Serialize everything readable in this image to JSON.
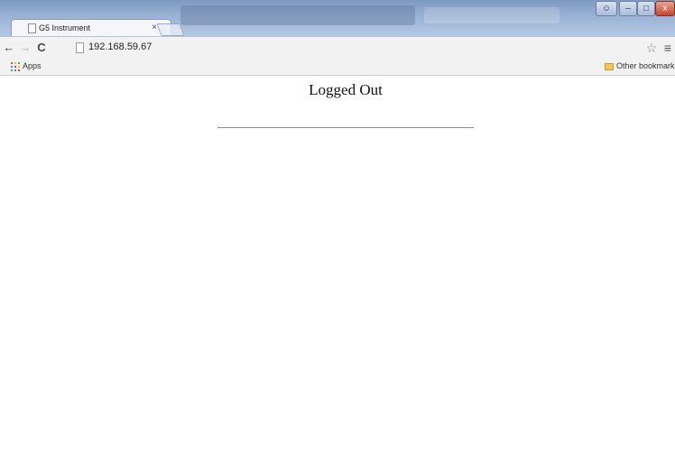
{
  "browser": {
    "tab": {
      "title": "G5 Instrument",
      "close_glyph": "×",
      "icon": "page-icon"
    },
    "window_controls": {
      "user_glyph": "☺",
      "minimize_glyph": "–",
      "maximize_glyph": "□",
      "close_glyph": "x"
    },
    "toolbar": {
      "back_glyph": "←",
      "forward_glyph": "→",
      "reload_glyph": "C",
      "url": "192.168.59.67",
      "star_glyph": "☆",
      "menu_glyph": "≡"
    },
    "bookmarks_bar": {
      "apps_label": "Apps",
      "other_bookmarks_label": "Other bookmarks",
      "apps_colors": [
        "#e8453c",
        "#f9bb2d",
        "#3bab5e",
        "#4a8af4",
        "#e8453c",
        "#f9bb2d",
        "#3bab5e",
        "#4a8af4",
        "#e8453c"
      ]
    }
  },
  "page": {
    "title": "Logged Out"
  }
}
